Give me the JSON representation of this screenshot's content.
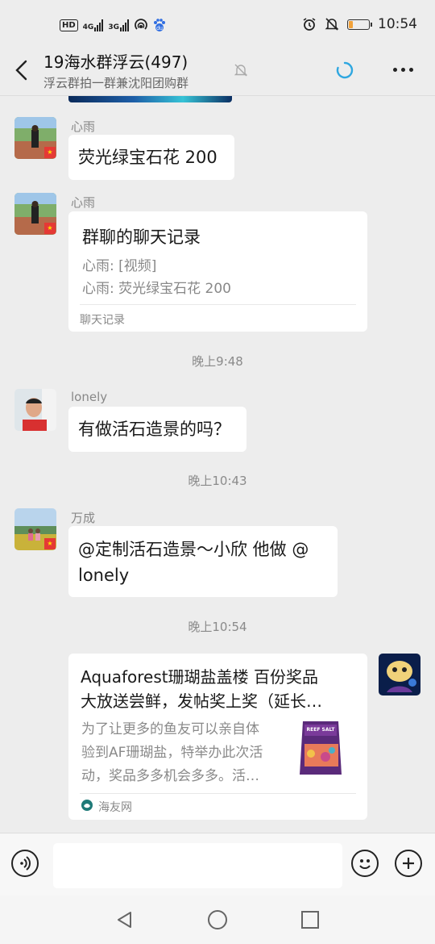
{
  "status_bar": {
    "left_icons": [
      "hd-icon",
      "4g-signal-icon",
      "3g-signal-icon",
      "hotspot-icon",
      "baidu-icon"
    ],
    "hd_label": "HD",
    "net1": "4G",
    "net2": "3G",
    "time": "10:54",
    "battery_level": 0.2
  },
  "header": {
    "title": "19海水群浮云(497)",
    "subtitle": "浮云群拍一群兼沈阳团购群"
  },
  "messages": [
    {
      "sender": "心雨",
      "text": "荧光绿宝石花 200"
    },
    {
      "sender": "心雨",
      "record": {
        "title": "群聊的聊天记录",
        "lines": [
          "心雨: [视频]",
          "心雨: 荧光绿宝石花 200"
        ],
        "footer": "聊天记录"
      }
    },
    {
      "time": "晚上9:48"
    },
    {
      "sender": "lonely",
      "text": "有做活石造景的吗？"
    },
    {
      "time": "晚上10:43"
    },
    {
      "sender": "万成",
      "text_line1": "@定制活石造景～小欣 他做 @",
      "text_line2": "lonely"
    },
    {
      "time": "晚上10:54"
    },
    {
      "link": {
        "title_line1": "Aquaforest珊瑚盐盖楼 百份奖品",
        "title_line2": "大放送尝鲜，发帖奖上奖（延长…",
        "desc_line1": "为了让更多的鱼友可以亲自体",
        "desc_line2": "验到AF珊瑚盐，特举办此次活",
        "desc_line3": "动，奖品多多机会多多。活…",
        "product_label": "REEF SALT",
        "source": "海友网"
      }
    }
  ],
  "input": {
    "placeholder": ""
  }
}
